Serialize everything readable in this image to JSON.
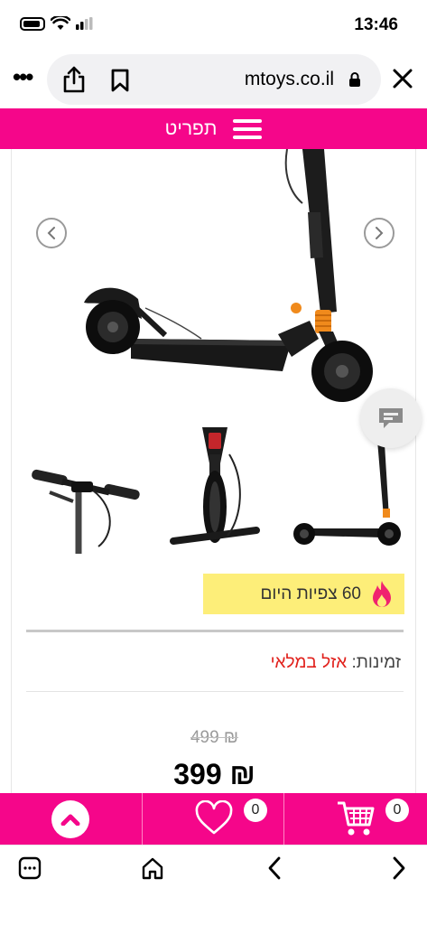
{
  "status_bar": {
    "time": "13:46"
  },
  "browser": {
    "host": "mtoys.co.il",
    "icons": [
      "more-icon",
      "share-icon",
      "bookmark-icon",
      "lock-icon",
      "close-icon"
    ]
  },
  "menu": {
    "label": "תפריט"
  },
  "product": {
    "views_count": "60",
    "views_label": "צפיות היום",
    "availability_label": "זמינות:",
    "availability_value": "אזל במלאי",
    "old_price": "499 ₪",
    "new_price": "399 ₪"
  },
  "action_bar": {
    "wishlist_count": "0",
    "cart_count": "0"
  },
  "colors": {
    "brand": "#f5068a",
    "views_badge": "#fdee79",
    "out_of_stock": "#e1211c"
  }
}
